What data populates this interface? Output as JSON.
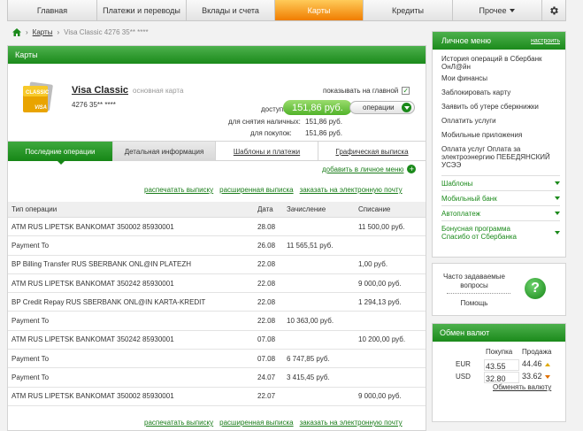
{
  "nav": {
    "items": [
      "Главная",
      "Платежи и переводы",
      "Вклады и счета",
      "Карты",
      "Кредиты",
      "Прочее"
    ],
    "active": "Карты",
    "settings_icon": "gear-icon"
  },
  "breadcrumb": {
    "cards": "Карты",
    "current": "Visa Classic 4276 35** ****"
  },
  "main": {
    "title": "Карты",
    "card": {
      "name": "Visa Classic",
      "primary": "основная карта",
      "number": "4276 35** ****",
      "image_text": "CLASSIC",
      "image_brand": "VISA",
      "show_on_main": "показывать на главной",
      "available_label": "доступно:",
      "available": "151,86 руб.",
      "ops_button": "операции",
      "cash_label": "для снятия наличных:",
      "cash_value": "151,86 руб.",
      "purchase_label": "для покупок:",
      "purchase_value": "151,86 руб."
    },
    "tabs": [
      "Последние операции",
      "Детальная информация",
      "Шаблоны и платежи",
      "Графическая выписка"
    ],
    "add_personal": "добавить в личное меню",
    "links": [
      "распечатать выписку",
      "расширенная выписка",
      "заказать на электронную почту"
    ],
    "table": {
      "headers": [
        "Тип операции",
        "Дата",
        "Зачисление",
        "Списание"
      ],
      "rows": [
        [
          "ATM RUS LIPETSK BANKOMAT 350002 85930001",
          "28.08",
          "",
          "11 500,00 руб."
        ],
        [
          "Payment To",
          "26.08",
          "11 565,51 руб.",
          ""
        ],
        [
          "BP Billing Transfer RUS SBERBANK ONL@IN PLATEZH",
          "22.08",
          "",
          "1,00 руб."
        ],
        [
          "ATM RUS LIPETSK BANKOMAT 350242 85930001",
          "22.08",
          "",
          "9 000,00 руб."
        ],
        [
          "BP Credit Repay RUS SBERBANK ONL@IN KARTA-KREDIT",
          "22.08",
          "",
          "1 294,13 руб."
        ],
        [
          "Payment To",
          "22.08",
          "10 363,00 руб.",
          ""
        ],
        [
          "ATM RUS LIPETSK BANKOMAT 350242 85930001",
          "07.08",
          "",
          "10 200,00 руб."
        ],
        [
          "Payment To",
          "07.08",
          "6 747,85 руб.",
          ""
        ],
        [
          "Payment To",
          "24.07",
          "3 415,45 руб.",
          ""
        ],
        [
          "ATM RUS LIPETSK BANKOMAT 350002 85930001",
          "22.07",
          "",
          "9 000,00 руб."
        ]
      ]
    }
  },
  "personal_menu": {
    "title": "Личное меню",
    "settings": "настроить",
    "items": [
      "История операций в Сбербанк ОнЛ@йн",
      "Мои финансы",
      "Заблокировать карту",
      "Заявить об утере сберкнижки",
      "Оплатить услуги",
      "Мобильные приложения",
      "Оплата услуг Оплата за электроэнергию ПЕБЕДЯНСКИЙ УСЭЭ"
    ],
    "accordion": [
      "Шаблоны",
      "Мобильный банк",
      "Автоплатеж",
      "Бонусная программа Спасибо от Сбербанка"
    ]
  },
  "faq": {
    "text": "Часто задаваемые вопросы",
    "help": "Помощь",
    "icon": "?"
  },
  "fx": {
    "title": "Обмен валют",
    "buy": "Покупка",
    "sell": "Продажа",
    "rows": [
      {
        "cur": "EUR",
        "buy": "43.55",
        "sell": "44.46",
        "trend": "up"
      },
      {
        "cur": "USD",
        "buy": "32.80",
        "sell": "33.62",
        "trend": "down"
      }
    ],
    "exchange_link": "Обменять валюту"
  }
}
